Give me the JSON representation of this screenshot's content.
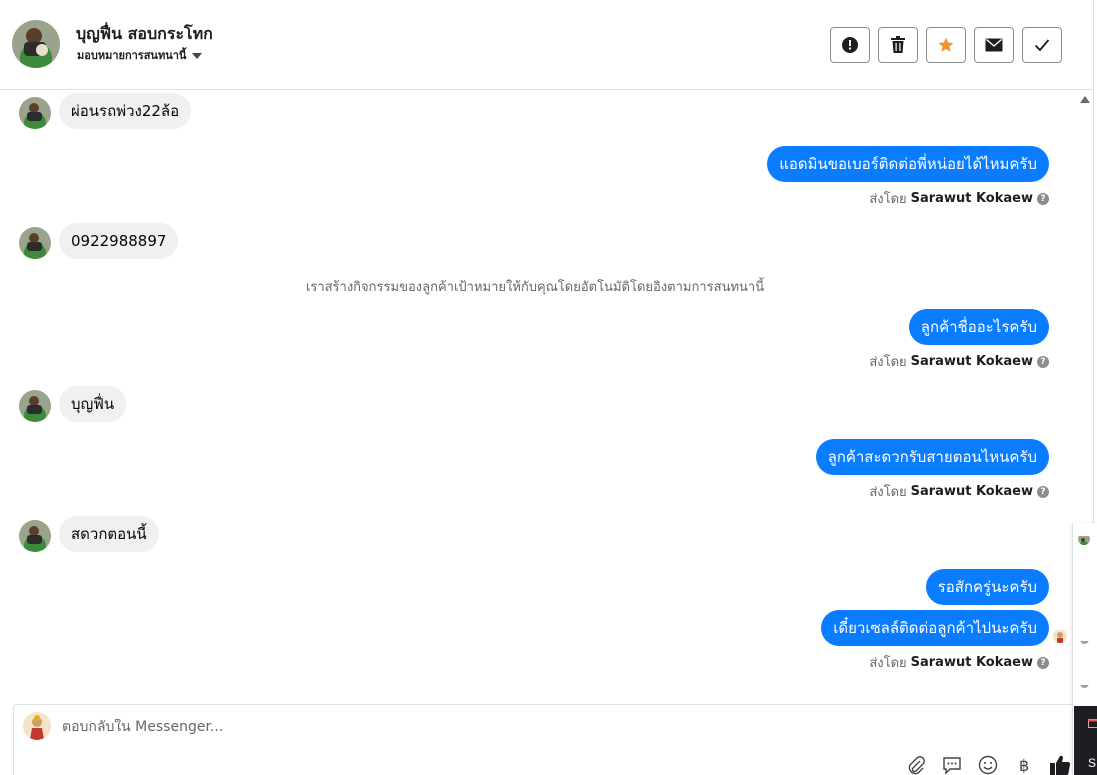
{
  "header": {
    "contact_name": "บุญฟื่น สอบกระโทก",
    "assign_label": "มอบหมายการสนทนานี้",
    "actions": [
      {
        "name": "spam-button",
        "icon": "exclamation-circle-icon"
      },
      {
        "name": "delete-button",
        "icon": "trash-icon"
      },
      {
        "name": "star-button",
        "icon": "star-icon"
      },
      {
        "name": "mark-unread-button",
        "icon": "envelope-icon"
      },
      {
        "name": "done-button",
        "icon": "checkmark-icon"
      }
    ]
  },
  "messages": [
    {
      "direction": "in",
      "text": "ผ่อนรถพ่วง22ล้อ"
    },
    {
      "direction": "out",
      "text": "แอดมินขอเบอร์ติดต่อพี่หน่อยได้ไหมครับ",
      "sent_by_prefix": "ส่งโดย",
      "sent_by_name": "Sarawut Kokaew"
    },
    {
      "direction": "in",
      "text": "0922988897"
    },
    {
      "direction": "system",
      "text": "เราสร้างกิจกรรมของลูกค้าเป้าหมายให้กับคุณโดยอัตโนมัติโดยอิงตามการสนทนานี้"
    },
    {
      "direction": "out",
      "text": "ลูกค้าชื่ออะไรครับ",
      "sent_by_prefix": "ส่งโดย",
      "sent_by_name": "Sarawut Kokaew"
    },
    {
      "direction": "in",
      "text": "บุญฟื่น"
    },
    {
      "direction": "out",
      "text": "ลูกค้าสะดวกรับสายตอนไหนครับ",
      "sent_by_prefix": "ส่งโดย",
      "sent_by_name": "Sarawut Kokaew"
    },
    {
      "direction": "in",
      "text": "สดวกตอนนี้"
    },
    {
      "direction": "out",
      "text": "รอสักครู่นะครับ"
    },
    {
      "direction": "out",
      "text": "เดี๋ยวเซลล์ติดต่อลูกค้าไปนะครับ",
      "sent_by_prefix": "ส่งโดย",
      "sent_by_name": "Sarawut Kokaew"
    }
  ],
  "reply": {
    "placeholder": "ตอบกลับใน Messenger...",
    "tools": [
      "paperclip-icon",
      "speech-bubble-icon",
      "smiley-icon",
      "baht-icon",
      "thumbs-up-icon"
    ]
  },
  "edge_panel": {
    "label": "S"
  },
  "colors": {
    "outgoing_bubble": "#0a7cff",
    "incoming_bubble": "#f0f0f0",
    "star": "#f5912c",
    "muted_text": "#65676b"
  }
}
